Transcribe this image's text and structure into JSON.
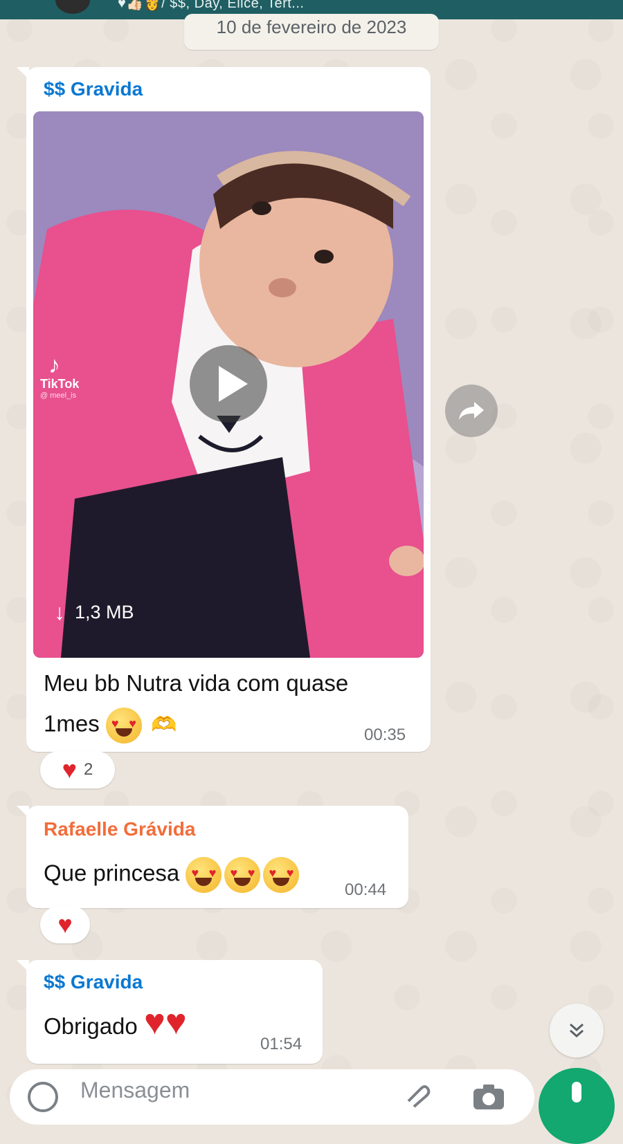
{
  "header": {
    "subtitle": "♥👍🏻👸/ $$, Day, Elicé, Tert..."
  },
  "date_chip": "10 de fevereiro de 2023",
  "messages": [
    {
      "sender": "$$ Gravida",
      "media": {
        "watermark": "TikTok",
        "handle": "@ meel_is",
        "size": "1,3 MB"
      },
      "text_line1": "Meu bb Nutra vida com quase",
      "text_line2": "1mes",
      "time": "00:35",
      "reaction_count": "2"
    },
    {
      "sender": "Rafaelle Grávida",
      "text": "Que princesa",
      "time": "00:44"
    },
    {
      "sender": "$$ Gravida",
      "text": "Obrigado",
      "time": "01:54"
    }
  ],
  "composer": {
    "placeholder": "Mensagem"
  },
  "colors": {
    "header": "#1f5f63",
    "sender_blue": "#0a78d2",
    "sender_orange": "#f26d3a",
    "mic": "#12a870",
    "chat_bg": "#ece5dd"
  },
  "icons": [
    "play-icon",
    "download-icon",
    "forward-icon",
    "heart-icon",
    "chevrons-down-icon",
    "emoji-icon",
    "attach-icon",
    "camera-icon",
    "mic-icon"
  ]
}
